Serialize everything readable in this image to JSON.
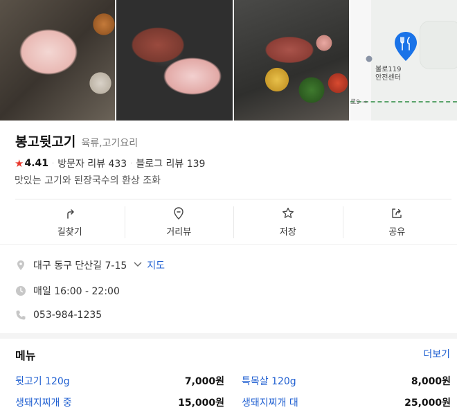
{
  "photos": [
    "photo-1",
    "photo-2",
    "photo-3"
  ],
  "map": {
    "poi_label_line1": "불로119",
    "poi_label_line2": "안전센터",
    "road_label": "로9 →"
  },
  "place": {
    "name": "봉고뒷고기",
    "category": "육류,고기요리",
    "rating": "4.41",
    "visitor_reviews": "방문자 리뷰 433",
    "blog_reviews": "블로그 리뷰 139",
    "description": "맛있는 고기와 된장국수의 환상 조화"
  },
  "actions": [
    {
      "label": "길찾기",
      "icon": "directions-icon"
    },
    {
      "label": "거리뷰",
      "icon": "street-view-icon"
    },
    {
      "label": "저장",
      "icon": "star-icon"
    },
    {
      "label": "공유",
      "icon": "share-icon"
    }
  ],
  "info": {
    "address": "대구 동구 단산길 7-15",
    "map_link": "지도",
    "hours": "매일 16:00 - 22:00",
    "phone": "053-984-1235"
  },
  "menu": {
    "title": "메뉴",
    "more": "더보기",
    "items": [
      {
        "name": "뒷고기 120g",
        "price": "7,000원"
      },
      {
        "name": "특목살 120g",
        "price": "8,000원"
      },
      {
        "name": "생돼지찌개 중",
        "price": "15,000원"
      },
      {
        "name": "생돼지찌개 대",
        "price": "25,000원"
      }
    ]
  },
  "colors": {
    "link": "#1f5fd1",
    "star": "#e8372c",
    "map_pin": "#1a73e8"
  }
}
